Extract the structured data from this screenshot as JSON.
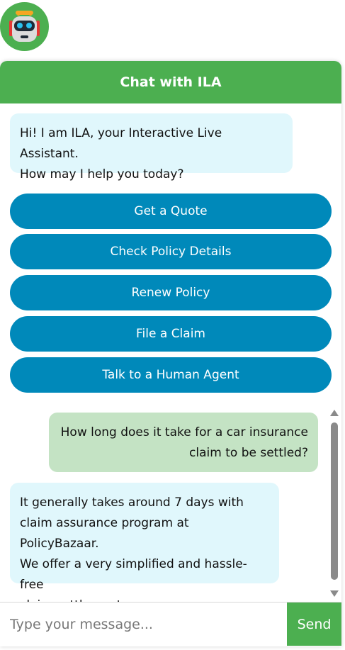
{
  "header": {
    "title": "Chat with ILA"
  },
  "greeting": {
    "line1": "Hi! I am ILA, your Interactive Live Assistant.",
    "line2": "How may I help you today?"
  },
  "quick_actions": [
    {
      "label": "Get a Quote"
    },
    {
      "label": "Check Policy Details"
    },
    {
      "label": "Renew Policy"
    },
    {
      "label": "File a Claim"
    },
    {
      "label": "Talk to a Human Agent"
    }
  ],
  "conversation": {
    "user_message": {
      "line1": "How long does it take for a car insurance",
      "line2": "claim to be settled?"
    },
    "bot_reply": {
      "line1": "It generally takes around 7 days with",
      "line2": "claim assurance program at PolicyBazaar.",
      "line3": "We offer a very simplified and hassle-free",
      "line4": "claim settlement process."
    }
  },
  "composer": {
    "placeholder": "Type your message...",
    "send_label": "Send"
  },
  "colors": {
    "brand_green": "#4caf50",
    "action_blue": "#0089ba",
    "bot_bubble": "#e0f7fc",
    "user_bubble": "#c4e3c4"
  },
  "icons": {
    "avatar": "robot-icon"
  }
}
